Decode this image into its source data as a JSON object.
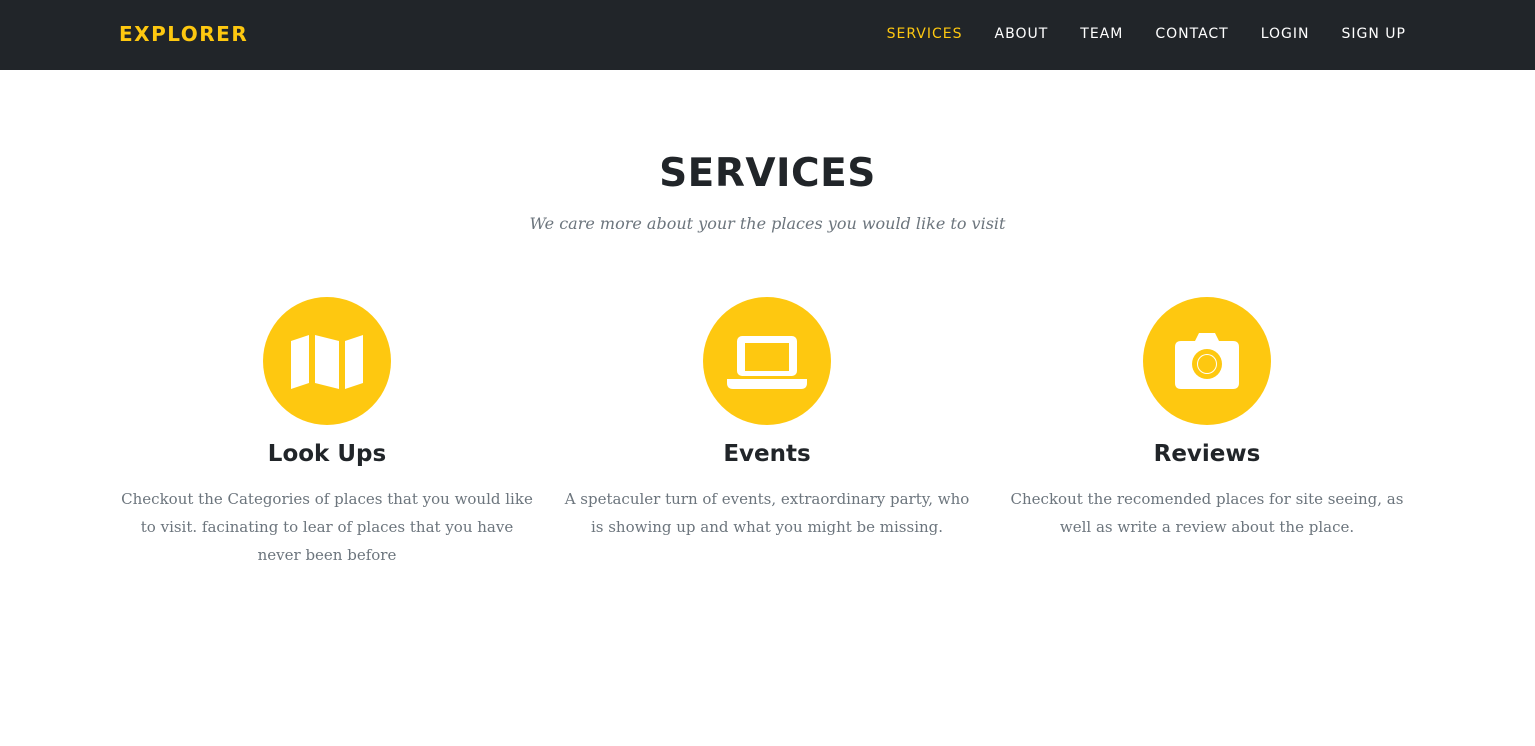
{
  "navbar": {
    "brand": "EXPLORER",
    "links": [
      {
        "label": "SERVICES",
        "active": true
      },
      {
        "label": "ABOUT",
        "active": false
      },
      {
        "label": "TEAM",
        "active": false
      },
      {
        "label": "CONTACT",
        "active": false
      },
      {
        "label": "LOGIN",
        "active": false
      },
      {
        "label": "SIGN UP",
        "active": false
      }
    ]
  },
  "section": {
    "title": "SERVICES",
    "subtitle": "We care more about your the places you would like to visit"
  },
  "services": [
    {
      "icon": "map-icon",
      "heading": "Look Ups",
      "text": "Checkout the Categories of places that you would like to visit. facinating to lear of places that you have never been before"
    },
    {
      "icon": "laptop-icon",
      "heading": "Events",
      "text": "A spetaculer turn of events, extraordinary party, who is showing up and what you might be missing."
    },
    {
      "icon": "camera-icon",
      "heading": "Reviews",
      "text": "Checkout the recomended places for site seeing, as well as write a review about the place."
    }
  ],
  "colors": {
    "accent": "#fec810",
    "navbar_bg": "#212529",
    "heading": "#212529",
    "muted_text": "#6c757d"
  }
}
